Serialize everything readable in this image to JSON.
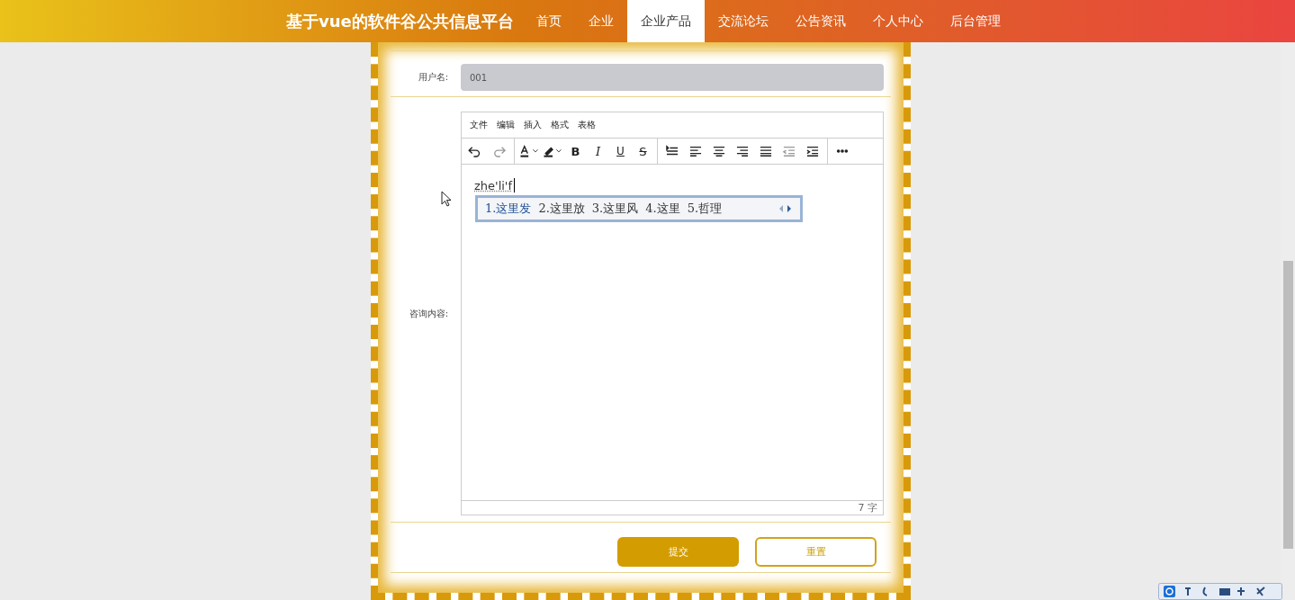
{
  "nav": {
    "title": "基于vue的软件谷公共信息平台",
    "items": [
      {
        "label": "首页",
        "selected": false
      },
      {
        "label": "企业",
        "selected": false
      },
      {
        "label": "企业产品",
        "selected": true
      },
      {
        "label": "交流论坛",
        "selected": false
      },
      {
        "label": "公告资讯",
        "selected": false
      },
      {
        "label": "个人中心",
        "selected": false
      },
      {
        "label": "后台管理",
        "selected": false
      }
    ]
  },
  "form": {
    "username": {
      "label": "用户名:",
      "value": "001",
      "disabled": true
    },
    "content": {
      "label": "咨询内容:",
      "menu": [
        "文件",
        "编辑",
        "插入",
        "格式",
        "表格"
      ],
      "toolbar": [
        [
          {
            "kind": "icon",
            "disabled": false
          },
          {
            "kind": "icon",
            "disabled": true
          }
        ],
        [
          {
            "kind": "icon",
            "disabled": false
          },
          {
            "kind": "icon",
            "disabled": false
          },
          {
            "kind": "char",
            "label": "B",
            "disabled": false
          },
          {
            "kind": "char",
            "label": "I",
            "disabled": false
          },
          {
            "kind": "char",
            "label": "U",
            "disabled": false
          },
          {
            "kind": "char",
            "label": "S",
            "disabled": false
          }
        ],
        [
          {
            "kind": "icon",
            "disabled": false
          },
          {
            "kind": "icon",
            "disabled": false
          },
          {
            "kind": "icon",
            "disabled": false
          },
          {
            "kind": "icon",
            "disabled": false
          },
          {
            "kind": "icon",
            "disabled": false
          },
          {
            "kind": "icon",
            "disabled": true
          },
          {
            "kind": "icon",
            "disabled": false
          }
        ],
        [
          {
            "kind": "icon",
            "disabled": false
          }
        ]
      ],
      "text": "zhe'li'f",
      "ime": {
        "candidates": [
          {
            "label": "1.这里发",
            "selected": true
          },
          {
            "label": "2.这里放",
            "selected": false
          },
          {
            "label": "3.这里风",
            "selected": false
          },
          {
            "label": "4.这里",
            "selected": false
          },
          {
            "label": "5.哲理",
            "selected": false
          }
        ]
      },
      "word_count": "7 字"
    },
    "buttons": [
      {
        "label": "提交",
        "kind": "primary"
      },
      {
        "label": "重置",
        "kind": "outline"
      }
    ]
  }
}
